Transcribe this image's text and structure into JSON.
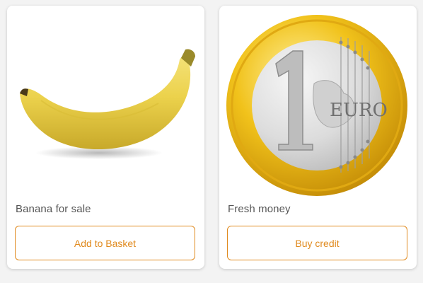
{
  "products": [
    {
      "caption": "Banana for sale",
      "button_label": "Add to Basket",
      "image": "banana"
    },
    {
      "caption": "Fresh money",
      "button_label": "Buy credit",
      "image": "one-euro-coin",
      "coin_text": "EURO",
      "coin_value": "1"
    }
  ],
  "colors": {
    "accent": "#e08a1e",
    "caption_text": "#555555",
    "card_background": "#ffffff",
    "page_background": "#f3f3f3"
  }
}
